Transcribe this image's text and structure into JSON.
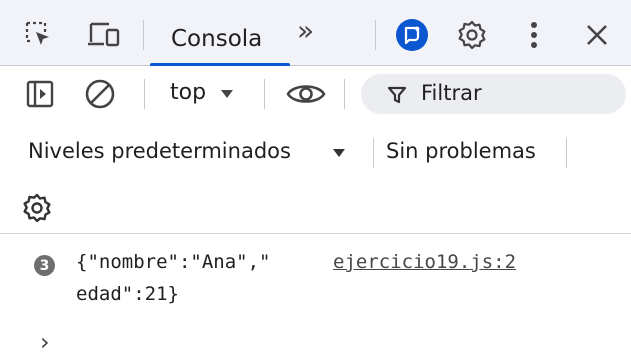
{
  "tabbar": {
    "active_tab": "Consola",
    "more_tabs": "»",
    "icons": [
      "inspect-element-icon",
      "device-toolbar-icon",
      "more-tabs-icon",
      "ai-assistance-icon",
      "settings-icon",
      "more-options-icon",
      "close-icon"
    ]
  },
  "toolbar": {
    "context_label": "top",
    "filter_label": "Filtrar",
    "icons": [
      "show-sidebar-icon",
      "clear-console-icon",
      "live-expression-icon",
      "filter-icon"
    ]
  },
  "levels": {
    "levels_label": "Niveles predeterminados",
    "issues_label": "Sin problemas"
  },
  "console": {
    "messages": [
      {
        "count": "3",
        "text_line1": "{\"nombre\":\"Ana\",\"",
        "text_line2": "edad\":21}",
        "source": "ejercicio19.js:2"
      }
    ],
    "prompt": "›"
  },
  "colors": {
    "accent": "#0b57d0",
    "tabbar_bg": "#f1f3f8",
    "filter_bg": "#ecedf1",
    "badge_bg": "#6e6e6e"
  }
}
